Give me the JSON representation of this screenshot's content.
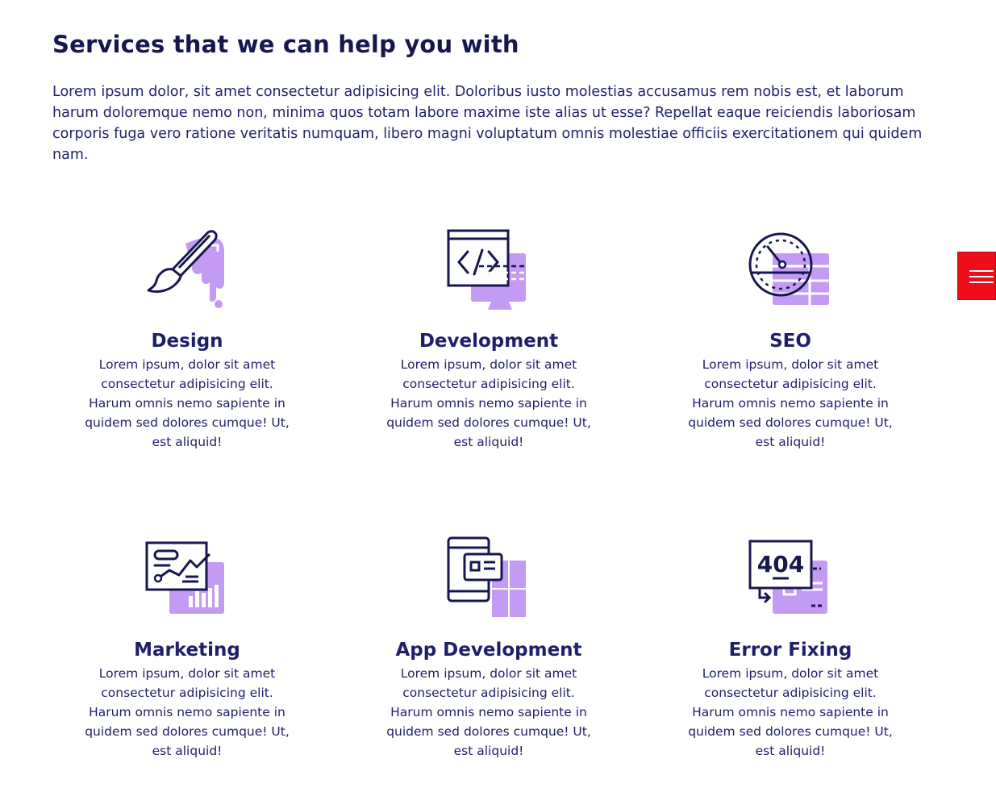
{
  "section": {
    "heading": "Services that we can help you with",
    "intro": "Lorem ipsum dolor, sit amet consectetur adipisicing elit. Doloribus iusto molestias accusamus rem nobis est, et laborum harum doloremque nemo non, minima quos totam labore maxime iste alias ut esse? Repellat eaque reiciendis laboriosam corporis fuga vero ratione veritatis numquam, libero magni voluptatum omnis molestiae officiis exercitationem qui quidem nam."
  },
  "colors": {
    "navy": "#17174f",
    "lavender": "#c39bf4",
    "menu_red": "#ee0d1a"
  },
  "services": [
    {
      "title": "Design",
      "icon": "paintbrush-icon",
      "desc": "Lorem ipsum, dolor sit amet consectetur adipisicing elit. Harum omnis nemo sapiente in quidem sed dolores cumque! Ut, est aliquid!"
    },
    {
      "title": "Development",
      "icon": "code-window-icon",
      "desc": "Lorem ipsum, dolor sit amet consectetur adipisicing elit. Harum omnis nemo sapiente in quidem sed dolores cumque! Ut, est aliquid!"
    },
    {
      "title": "SEO",
      "icon": "speedometer-icon",
      "desc": "Lorem ipsum, dolor sit amet consectetur adipisicing elit. Harum omnis nemo sapiente in quidem sed dolores cumque! Ut, est aliquid!"
    },
    {
      "title": "Marketing",
      "icon": "analytics-chart-icon",
      "desc": "Lorem ipsum, dolor sit amet consectetur adipisicing elit. Harum omnis nemo sapiente in quidem sed dolores cumque! Ut, est aliquid!"
    },
    {
      "title": "App Development",
      "icon": "mobile-app-icon",
      "desc": "Lorem ipsum, dolor sit amet consectetur adipisicing elit. Harum omnis nemo sapiente in quidem sed dolores cumque! Ut, est aliquid!"
    },
    {
      "title": "Error Fixing",
      "icon": "error-404-icon",
      "desc": "Lorem ipsum, dolor sit amet consectetur adipisicing elit. Harum omnis nemo sapiente in quidem sed dolores cumque! Ut, est aliquid!"
    }
  ],
  "error_icon_text": "404",
  "menu": {
    "icon": "hamburger-menu-icon"
  }
}
